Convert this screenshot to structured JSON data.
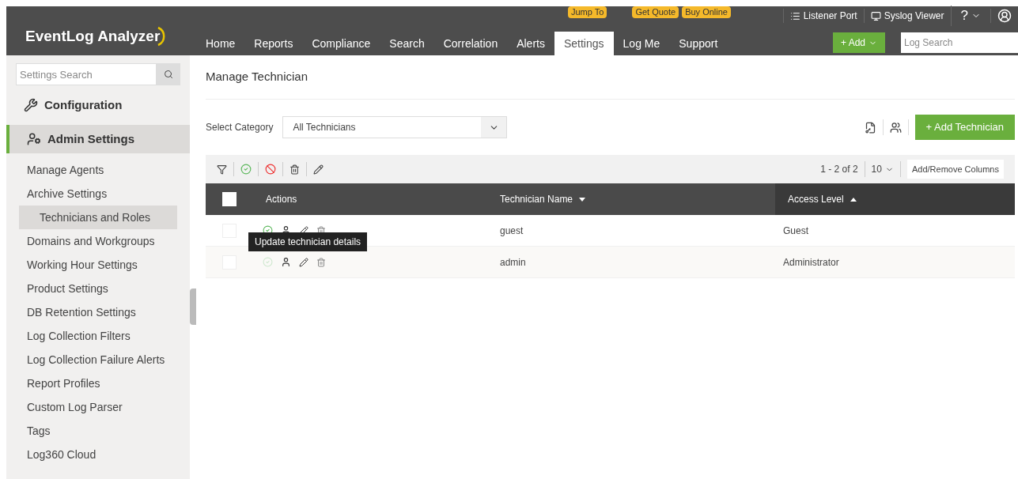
{
  "header": {
    "logo": "EventLog Analyzer",
    "badges": [
      "Jump To",
      "Get Quote",
      "Buy Online"
    ],
    "links": [
      {
        "kind": "list",
        "label": "Listener Port"
      },
      {
        "kind": "monitor",
        "label": "Syslog Viewer"
      }
    ],
    "help": "?",
    "nav": [
      {
        "label": "Home",
        "selected": false
      },
      {
        "label": "Reports",
        "selected": false
      },
      {
        "label": "Compliance",
        "selected": false
      },
      {
        "label": "Search",
        "selected": false
      },
      {
        "label": "Correlation",
        "selected": false
      },
      {
        "label": "Alerts",
        "selected": false
      },
      {
        "label": "Settings",
        "selected": true
      },
      {
        "label": "Log Me",
        "selected": false
      },
      {
        "label": "Support",
        "selected": false
      }
    ],
    "add_button": "+ Add",
    "search": {
      "placeholder": "Log Search"
    }
  },
  "sidebar": {
    "search": {
      "placeholder": "Settings Search"
    },
    "sections": [
      {
        "kind": "tools",
        "label": "Configuration",
        "selected": false
      },
      {
        "kind": "admin",
        "label": "Admin Settings",
        "selected": true
      }
    ],
    "items": [
      {
        "label": "Manage Agents",
        "selected": false
      },
      {
        "label": "Archive Settings",
        "selected": false
      },
      {
        "label": "Technicians and Roles",
        "selected": true
      },
      {
        "label": "Domains and Workgroups",
        "selected": false
      },
      {
        "label": "Working Hour Settings",
        "selected": false
      },
      {
        "label": "Product Settings",
        "selected": false
      },
      {
        "label": "DB Retention Settings",
        "selected": false
      },
      {
        "label": "Log Collection Filters",
        "selected": false
      },
      {
        "label": "Log Collection Failure Alerts",
        "selected": false
      },
      {
        "label": "Report Profiles",
        "selected": false
      },
      {
        "label": "Custom Log Parser",
        "selected": false
      },
      {
        "label": "Tags",
        "selected": false
      },
      {
        "label": "Log360 Cloud",
        "selected": false
      }
    ]
  },
  "page": {
    "title": "Manage Technician",
    "category_label": "Select Category",
    "category_value": "All Technicians",
    "add_button": "+ Add Technician",
    "pagination": "1 - 2 of 2",
    "page_size": "10",
    "columns_button": "Add/Remove Columns",
    "table": {
      "all_checked": false,
      "columns": [
        {
          "label": "Actions",
          "kind": "plain"
        },
        {
          "label": "Technician Name",
          "kind": "sort-desc"
        },
        {
          "label": "Access Level",
          "kind": "sort-asc"
        }
      ],
      "rows": [
        {
          "name": "guest",
          "access": "Guest",
          "checked": false,
          "active": true
        },
        {
          "name": "admin",
          "access": "Administrator",
          "checked": false,
          "active": false
        }
      ]
    },
    "tooltip": "Update technician details"
  }
}
